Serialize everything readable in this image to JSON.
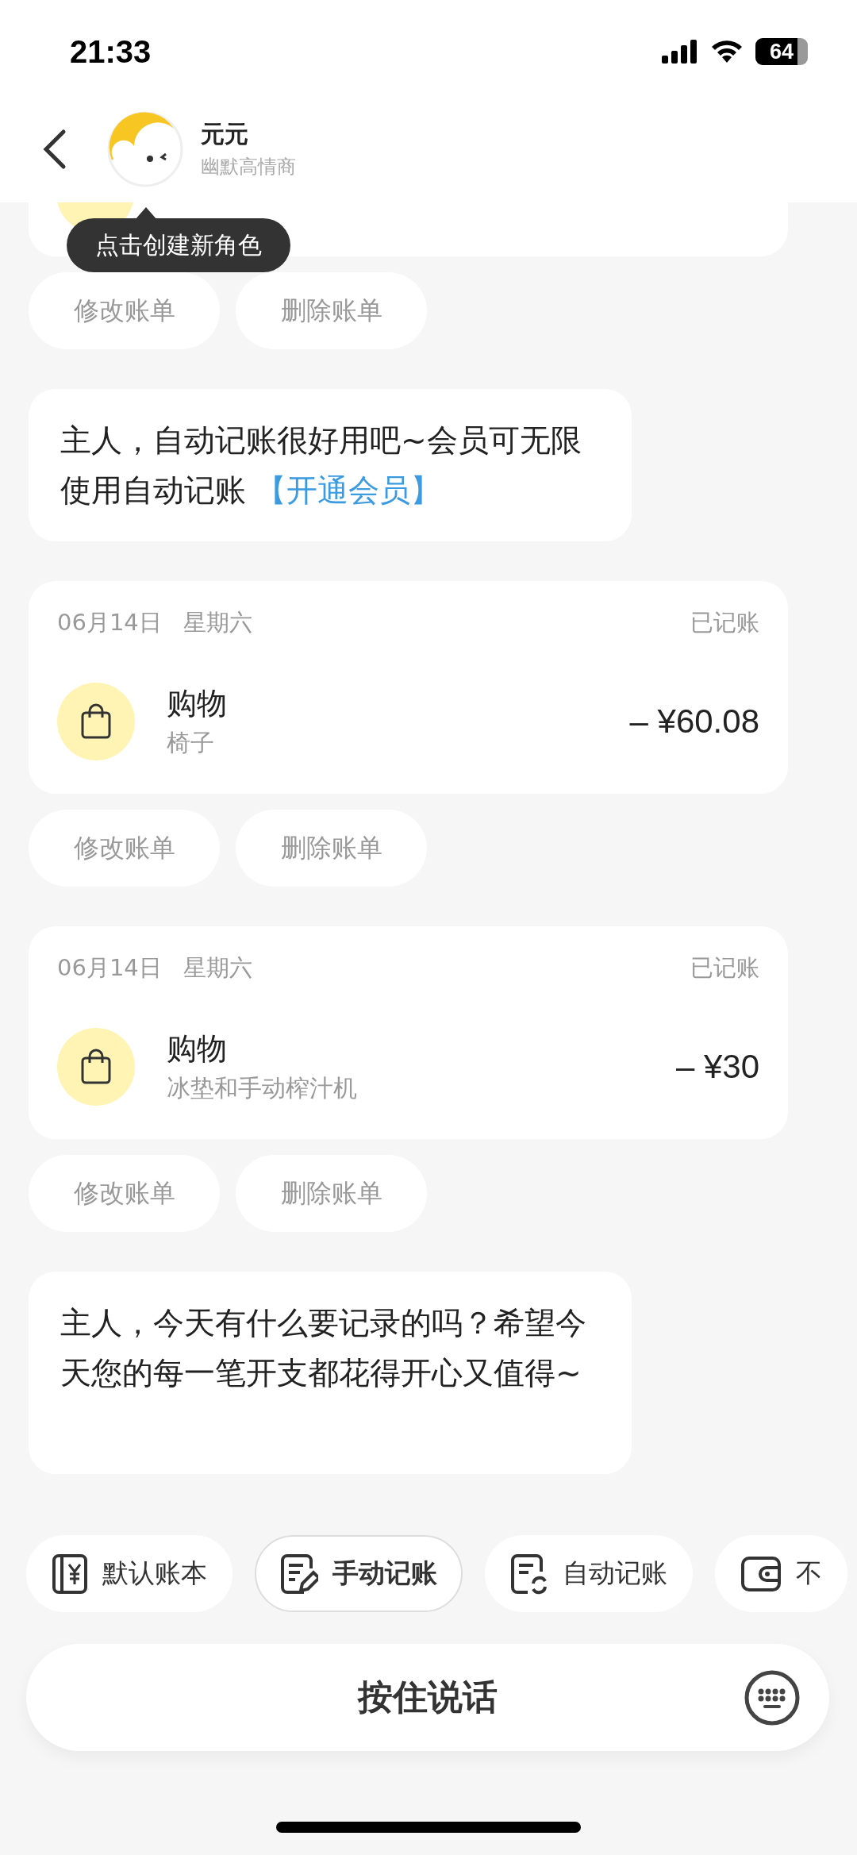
{
  "status_bar": {
    "time": "21:33",
    "battery": "64"
  },
  "header": {
    "name": "元元",
    "subtitle": "幽默高情商",
    "tooltip": "点击创建新角色"
  },
  "messages": [
    {
      "kind": "record_tail",
      "actions": [
        "修改账单",
        "删除账单"
      ]
    },
    {
      "kind": "bubble",
      "text": "主人，自动记账很好用吧~会员可无限使用自动记账 ",
      "link": "【开通会员】"
    },
    {
      "kind": "record",
      "date": "06月14日",
      "weekday": "星期六",
      "status": "已记账",
      "category": "购物",
      "note": "椅子",
      "amount": "– ¥60.08",
      "actions": [
        "修改账单",
        "删除账单"
      ]
    },
    {
      "kind": "record",
      "date": "06月14日",
      "weekday": "星期六",
      "status": "已记账",
      "category": "购物",
      "note": "冰垫和手动榨汁机",
      "amount": "– ¥30",
      "actions": [
        "修改账单",
        "删除账单"
      ]
    },
    {
      "kind": "bubble",
      "text": "主人，今天有什么要记录的吗？希望今天您的每一笔开支都花得开心又值得~"
    }
  ],
  "chips": [
    {
      "label": "默认账本",
      "selected": false
    },
    {
      "label": "手动记账",
      "selected": true
    },
    {
      "label": "自动记账",
      "selected": false
    },
    {
      "label": "不",
      "selected": false
    }
  ],
  "voice_bar": {
    "label": "按住说话"
  }
}
